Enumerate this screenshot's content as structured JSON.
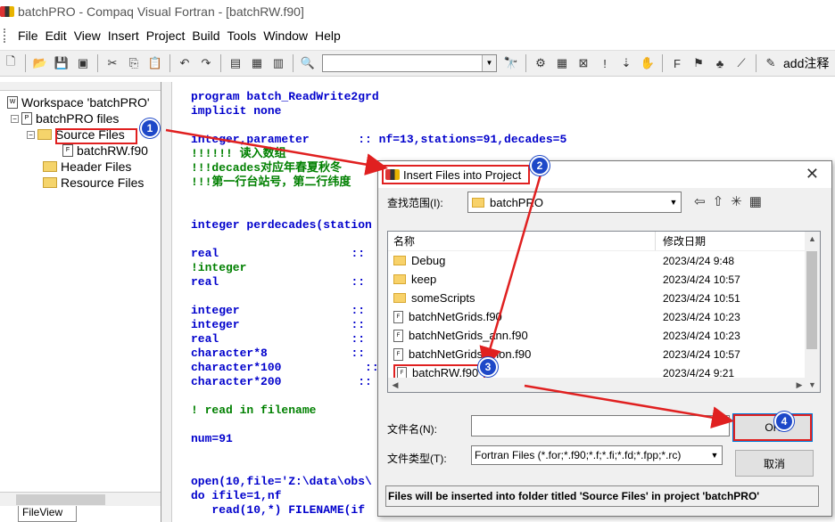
{
  "window": {
    "title": "batchPRO - Compaq Visual Fortran - [batchRW.f90]"
  },
  "menu": [
    "File",
    "Edit",
    "View",
    "Insert",
    "Project",
    "Build",
    "Tools",
    "Window",
    "Help"
  ],
  "toolbar": {
    "add_note_label": "add注释"
  },
  "workspace": {
    "root": "Workspace 'batchPRO'",
    "project": "batchPRO files",
    "source_folder": "Source Files",
    "source_file": "batchRW.f90",
    "header_folder": "Header Files",
    "resource_folder": "Resource Files",
    "tab": "FileView"
  },
  "code": {
    "l1": "program batch_ReadWrite2grd",
    "l2": "implicit none",
    "l3a": "integer,parameter",
    "l3b": "       :: nf=13,stations=91,decades=5",
    "c1": "!!!!!! 读入数组",
    "c2": "!!!decades对应年春夏秋冬",
    "c3": "!!!第一行台站号，第二行纬度",
    "l4": "integer perdecades(station",
    "l5": "real",
    "c4": "!integer",
    "l6": "real",
    "l7": "integer",
    "l8": "integer",
    "l9": "real",
    "l10": "character*8",
    "l11": "character*100",
    "l12": "character*200",
    "c5": "! read in filename",
    "l13": "num=91",
    "l14": "open(10,file='Z:\\data\\obs\\",
    "l15": "do ifile=1,nf",
    "l16": "   read(10,*) FILENAME(if",
    "colons": "::"
  },
  "dialog": {
    "title": "Insert Files into Project",
    "look_in_label": "查找范围(I):",
    "look_in_value": "batchPRO",
    "col_name": "名称",
    "col_date": "修改日期",
    "files": [
      {
        "name": "Debug",
        "date": "2023/4/24 9:48",
        "type": "folder"
      },
      {
        "name": "keep",
        "date": "2023/4/24 10:57",
        "type": "folder"
      },
      {
        "name": "someScripts",
        "date": "2023/4/24 10:51",
        "type": "folder"
      },
      {
        "name": "batchNetGrids.f90",
        "date": "2023/4/24 10:23",
        "type": "file"
      },
      {
        "name": "batchNetGrids_ann.f90",
        "date": "2023/4/24 10:23",
        "type": "file"
      },
      {
        "name": "batchNetGrids_mon.f90",
        "date": "2023/4/24 10:57",
        "type": "file"
      },
      {
        "name": "batchRW.f90",
        "date": "2023/4/24 9:21",
        "type": "file"
      }
    ],
    "filename_label": "文件名(N):",
    "filename_value": "",
    "filetype_label": "文件类型(T):",
    "filetype_value": "Fortran Files (*.for;*.f90;*.f;*.fi;*.fd;*.fpp;*.rc)",
    "ok_label": "OK",
    "cancel_label": "取消",
    "status": "Files will be inserted into folder titled 'Source Files' in project 'batchPRO'"
  },
  "badges": [
    "1",
    "2",
    "3",
    "4"
  ],
  "colors": {
    "annotation_red": "#e02020",
    "badge_blue": "#1e48c8",
    "keyword_blue": "#0000cc",
    "comment_green": "#008000"
  }
}
